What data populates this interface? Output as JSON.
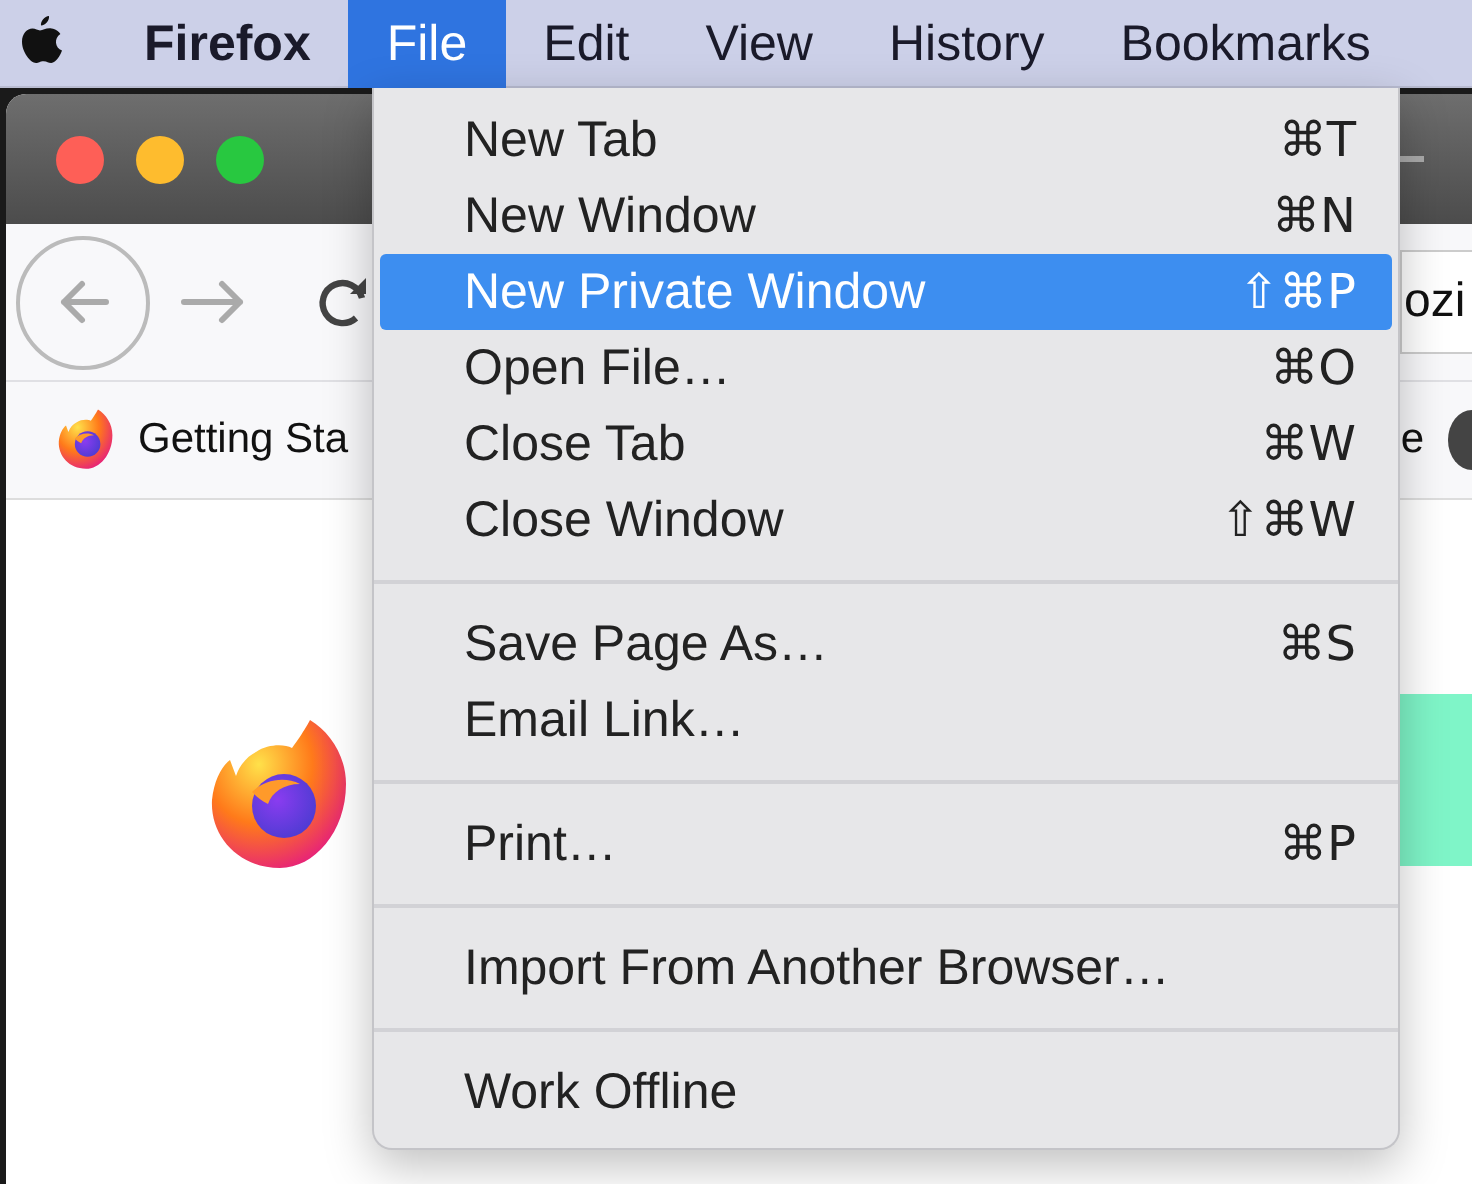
{
  "menu_bar": {
    "items": [
      {
        "label": "Firefox",
        "kind": "app",
        "selected": false
      },
      {
        "label": "File",
        "kind": "menu",
        "selected": true
      },
      {
        "label": "Edit",
        "kind": "menu",
        "selected": false
      },
      {
        "label": "View",
        "kind": "menu",
        "selected": false
      },
      {
        "label": "History",
        "kind": "menu",
        "selected": false
      },
      {
        "label": "Bookmarks",
        "kind": "menu",
        "selected": false
      }
    ]
  },
  "browser": {
    "bookmarks": [
      {
        "label": "Getting Sta"
      }
    ],
    "url_fragment": "ozi",
    "bookmark_fragment": "e"
  },
  "file_menu": {
    "items": [
      {
        "kind": "item",
        "label": "New Tab",
        "shortcut": "⌘T",
        "selected": false
      },
      {
        "kind": "item",
        "label": "New Window",
        "shortcut": "⌘N",
        "selected": false
      },
      {
        "kind": "item",
        "label": "New Private Window",
        "shortcut": "⇧⌘P",
        "selected": true
      },
      {
        "kind": "item",
        "label": "Open File…",
        "shortcut": "⌘O",
        "selected": false
      },
      {
        "kind": "item",
        "label": "Close Tab",
        "shortcut": "⌘W",
        "selected": false
      },
      {
        "kind": "item",
        "label": "Close Window",
        "shortcut": "⇧⌘W",
        "selected": false
      },
      {
        "kind": "separator"
      },
      {
        "kind": "item",
        "label": "Save Page As…",
        "shortcut": "⌘S",
        "selected": false
      },
      {
        "kind": "item",
        "label": "Email Link…",
        "selected": false
      },
      {
        "kind": "separator"
      },
      {
        "kind": "item",
        "label": "Print…",
        "shortcut": "⌘P",
        "selected": false
      },
      {
        "kind": "separator"
      },
      {
        "kind": "item",
        "label": "Import From Another Browser…",
        "selected": false
      },
      {
        "kind": "separator"
      },
      {
        "kind": "item",
        "label": "Work Offline",
        "selected": false
      }
    ]
  }
}
